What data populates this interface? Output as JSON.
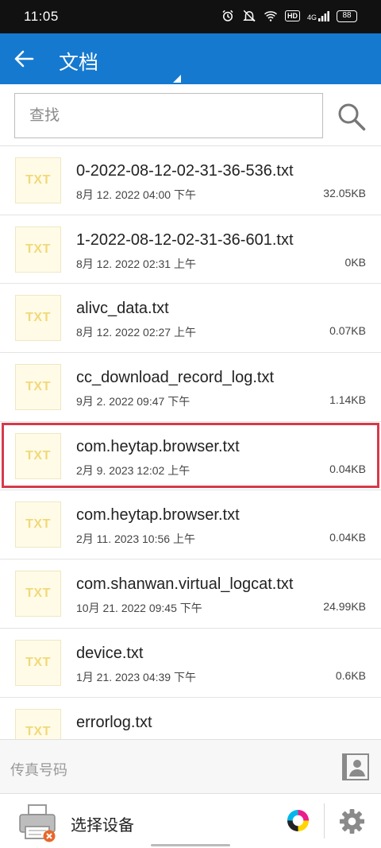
{
  "status_bar": {
    "time": "11:05",
    "icons": [
      "alarm-icon",
      "mute-icon",
      "wifi-icon",
      "hd-icon",
      "signal-4g-icon"
    ],
    "hd_label": "HD",
    "network_label": "4G",
    "battery": "88"
  },
  "header": {
    "back_icon": "arrow-left-icon",
    "title": "文档",
    "background_color": "#1579cf"
  },
  "search": {
    "placeholder": "查找",
    "value": "",
    "icon": "search-icon"
  },
  "file_type_label": "TXT",
  "files": [
    {
      "name": "0-2022-08-12-02-31-36-536.txt",
      "date": "8月 12. 2022 04:00 下午",
      "size": "32.05KB",
      "selected": false
    },
    {
      "name": "1-2022-08-12-02-31-36-601.txt",
      "date": "8月 12. 2022 02:31 上午",
      "size": "0KB",
      "selected": false
    },
    {
      "name": "alivc_data.txt",
      "date": "8月 12. 2022 02:27 上午",
      "size": "0.07KB",
      "selected": false
    },
    {
      "name": "cc_download_record_log.txt",
      "date": "9月 2. 2022 09:47 下午",
      "size": "1.14KB",
      "selected": false
    },
    {
      "name": "com.heytap.browser.txt",
      "date": "2月 9. 2023 12:02 上午",
      "size": "0.04KB",
      "selected": true
    },
    {
      "name": "com.heytap.browser.txt",
      "date": "2月 11. 2023 10:56 上午",
      "size": "0.04KB",
      "selected": false
    },
    {
      "name": "com.shanwan.virtual_logcat.txt",
      "date": "10月 21. 2022 09:45 下午",
      "size": "24.99KB",
      "selected": false
    },
    {
      "name": "device.txt",
      "date": "1月 21. 2023 04:39 下午",
      "size": "0.6KB",
      "selected": false
    },
    {
      "name": "errorlog.txt",
      "date": "",
      "size": "",
      "selected": false
    }
  ],
  "selection_color": "#d63a4a",
  "fax": {
    "label": "传真号码",
    "icon": "contact-book-icon"
  },
  "device": {
    "label": "选择设备",
    "printer_icon": "printer-error-icon",
    "ink_icon": "ink-level-icon",
    "settings_icon": "gear-icon"
  }
}
